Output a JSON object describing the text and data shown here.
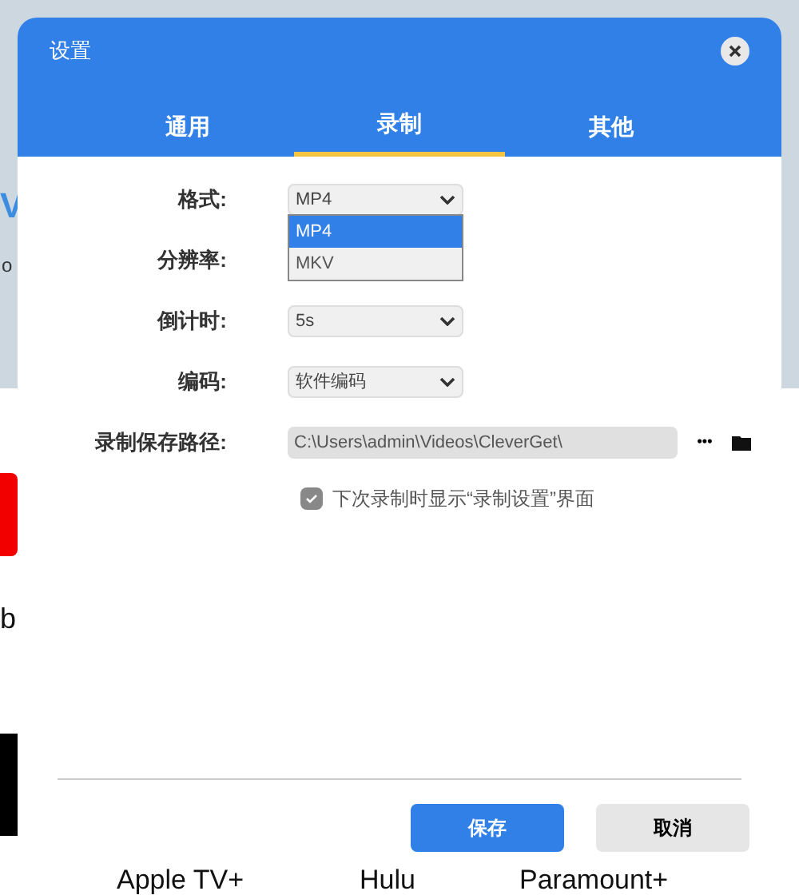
{
  "background": {
    "side_texts": [
      "V",
      "o",
      "b"
    ],
    "services": [
      "Apple TV+",
      "Hulu",
      "Paramount+"
    ]
  },
  "dialog": {
    "title": "设置",
    "tabs": [
      {
        "label": "通用",
        "selected": false
      },
      {
        "label": "录制",
        "selected": true
      },
      {
        "label": "其他",
        "selected": false
      }
    ],
    "fields": [
      {
        "kind": "select",
        "label": "格式:",
        "value": "MP4",
        "expanded": true,
        "options": [
          {
            "label": "MP4",
            "selected": true
          },
          {
            "label": "MKV",
            "selected": false
          }
        ]
      },
      {
        "kind": "covered",
        "label": "分辨率:"
      },
      {
        "kind": "select",
        "label": "倒计时:",
        "value": "5s"
      },
      {
        "kind": "select",
        "label": "编码:",
        "value": "软件编码"
      },
      {
        "kind": "path",
        "label": "录制保存路径:",
        "value": "C:\\Users\\admin\\Videos\\CleverGet\\",
        "more": "•••"
      }
    ],
    "checkbox": {
      "label": "下次录制时显示“录制设置”界面",
      "checked": true
    },
    "buttons": [
      {
        "label": "保存",
        "kind": "primary"
      },
      {
        "label": "取消",
        "kind": "secondary"
      }
    ]
  }
}
